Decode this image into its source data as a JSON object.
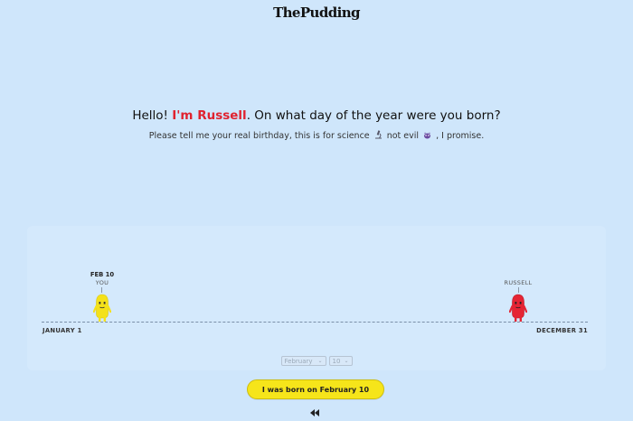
{
  "header": {
    "logo": "ThePudding"
  },
  "intro": {
    "hello": "Hello! ",
    "name_intro": "I'm Russell",
    "question": ". On what day of the year were you born?",
    "sub_before": "Please tell me your real birthday, this is for science",
    "sub_middle": "not evil",
    "sub_after": ", I promise."
  },
  "timeline": {
    "start_label": "JANUARY 1",
    "end_label": "DECEMBER 31",
    "you": {
      "date": "FEB 10",
      "label": "YOU",
      "color": "#f4e11a"
    },
    "russell": {
      "label": "RUSSELL",
      "color": "#e52534"
    }
  },
  "form": {
    "month": "February",
    "day": "10",
    "submit_label": "I was born on February 10"
  },
  "icons": {
    "science": "microscope-icon",
    "evil": "devil-icon",
    "rewind": "rewind-icon",
    "dropdown": "chevron-down-icon"
  }
}
